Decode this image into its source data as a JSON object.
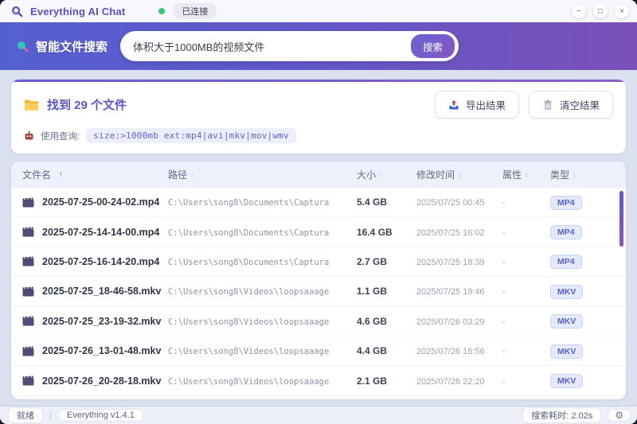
{
  "window": {
    "title": "Everything AI Chat",
    "connection_status": "已连接",
    "controls": {
      "minimize": "−",
      "maximize": "□",
      "close": "×"
    }
  },
  "search": {
    "label": "智能文件搜索",
    "query_value": "体积大于1000MB的视频文件",
    "search_button": "搜索"
  },
  "results": {
    "summary": "找到 29 个文件",
    "export_button": "导出结果",
    "clear_button": "清空结果",
    "query_label": "使用查询:",
    "query_string": "size:>1000mb ext:mp4|avi|mkv|mov|wmv"
  },
  "table": {
    "columns": {
      "name": "文件名",
      "path": "路径",
      "size": "大小",
      "modified": "修改时间",
      "attr": "属性",
      "type": "类型"
    },
    "sort_asc_indicator": "↑",
    "sort_idle_indicator": "↕",
    "rows": [
      {
        "name": "2025-07-25-00-24-02.mp4",
        "path": "C:\\Users\\song8\\Documents\\Captura",
        "size": "5.4 GB",
        "modified": "2025/07/25 00:45",
        "attr": "-",
        "type": "MP4"
      },
      {
        "name": "2025-07-25-14-14-00.mp4",
        "path": "C:\\Users\\song8\\Documents\\Captura",
        "size": "16.4 GB",
        "modified": "2025/07/25 16:02",
        "attr": "-",
        "type": "MP4"
      },
      {
        "name": "2025-07-25-16-14-20.mp4",
        "path": "C:\\Users\\song8\\Documents\\Captura",
        "size": "2.7 GB",
        "modified": "2025/07/25 18:39",
        "attr": "-",
        "type": "MP4"
      },
      {
        "name": "2025-07-25_18-46-58.mkv",
        "path": "C:\\Users\\song8\\Videos\\loopsaaage",
        "size": "1.1 GB",
        "modified": "2025/07/25 19:46",
        "attr": "-",
        "type": "MKV"
      },
      {
        "name": "2025-07-25_23-19-32.mkv",
        "path": "C:\\Users\\song8\\Videos\\loopsaaage",
        "size": "4.6 GB",
        "modified": "2025/07/26 03:29",
        "attr": "-",
        "type": "MKV"
      },
      {
        "name": "2025-07-26_13-01-48.mkv",
        "path": "C:\\Users\\song8\\Videos\\loopsaaage",
        "size": "4.4 GB",
        "modified": "2025/07/26 16:56",
        "attr": "-",
        "type": "MKV"
      },
      {
        "name": "2025-07-26_20-28-18.mkv",
        "path": "C:\\Users\\song8\\Videos\\loopsaaage",
        "size": "2.1 GB",
        "modified": "2025/07/26 22:20",
        "attr": "-",
        "type": "MKV"
      }
    ]
  },
  "statusbar": {
    "ready": "就绪",
    "version": "Everything v1.4.1",
    "elapsed": "搜索耗时: 2.02s",
    "gear": "⚙"
  },
  "colors": {
    "header_gradient_start": "#5560cf",
    "header_gradient_end": "#7b50b8",
    "accent_purple": "#5b55cf",
    "connected_green": "#2ecc71",
    "badge_text": "#5563d6",
    "badge_bg": "#e4e9fc"
  }
}
